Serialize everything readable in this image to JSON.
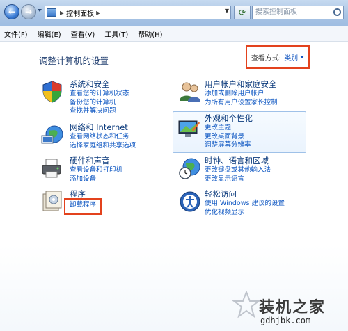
{
  "address": {
    "location": "控制面板",
    "search_placeholder": "搜索控制面板"
  },
  "menu": [
    "文件(F)",
    "编辑(E)",
    "查看(V)",
    "工具(T)",
    "帮助(H)"
  ],
  "page_title": "调整计算机的设置",
  "view_by": {
    "label": "查看方式:",
    "value": "类别"
  },
  "categories_left": [
    {
      "title": "系统和安全",
      "links": [
        "查看您的计算机状态",
        "备份您的计算机",
        "查找并解决问题"
      ],
      "icon": "shield-icon"
    },
    {
      "title": "网络和 Internet",
      "links": [
        "查看网络状态和任务",
        "选择家庭组和共享选项"
      ],
      "icon": "network-globe-icon"
    },
    {
      "title": "硬件和声音",
      "links": [
        "查看设备和打印机",
        "添加设备"
      ],
      "icon": "printer-icon"
    },
    {
      "title": "程序",
      "links": [
        "卸载程序"
      ],
      "icon": "programs-icon"
    }
  ],
  "categories_right": [
    {
      "title": "用户帐户和家庭安全",
      "links": [
        "添加或删除用户帐户",
        "为所有用户设置家长控制"
      ],
      "icon": "users-icon"
    },
    {
      "title": "外观和个性化",
      "links": [
        "更改主题",
        "更改桌面背景",
        "调整屏幕分辨率"
      ],
      "icon": "appearance-icon"
    },
    {
      "title": "时钟、语言和区域",
      "links": [
        "更改键盘或其他输入法",
        "更改显示语言"
      ],
      "icon": "clock-globe-icon"
    },
    {
      "title": "轻松访问",
      "links": [
        "使用 Windows 建议的设置",
        "优化视频显示"
      ],
      "icon": "accessibility-icon"
    }
  ],
  "watermark": {
    "title": "装机之家",
    "url": "gdhjbk.com"
  },
  "colors": {
    "highlight_box": "#e3421d",
    "link": "#0d56c2",
    "title": "#0b3a7c"
  }
}
